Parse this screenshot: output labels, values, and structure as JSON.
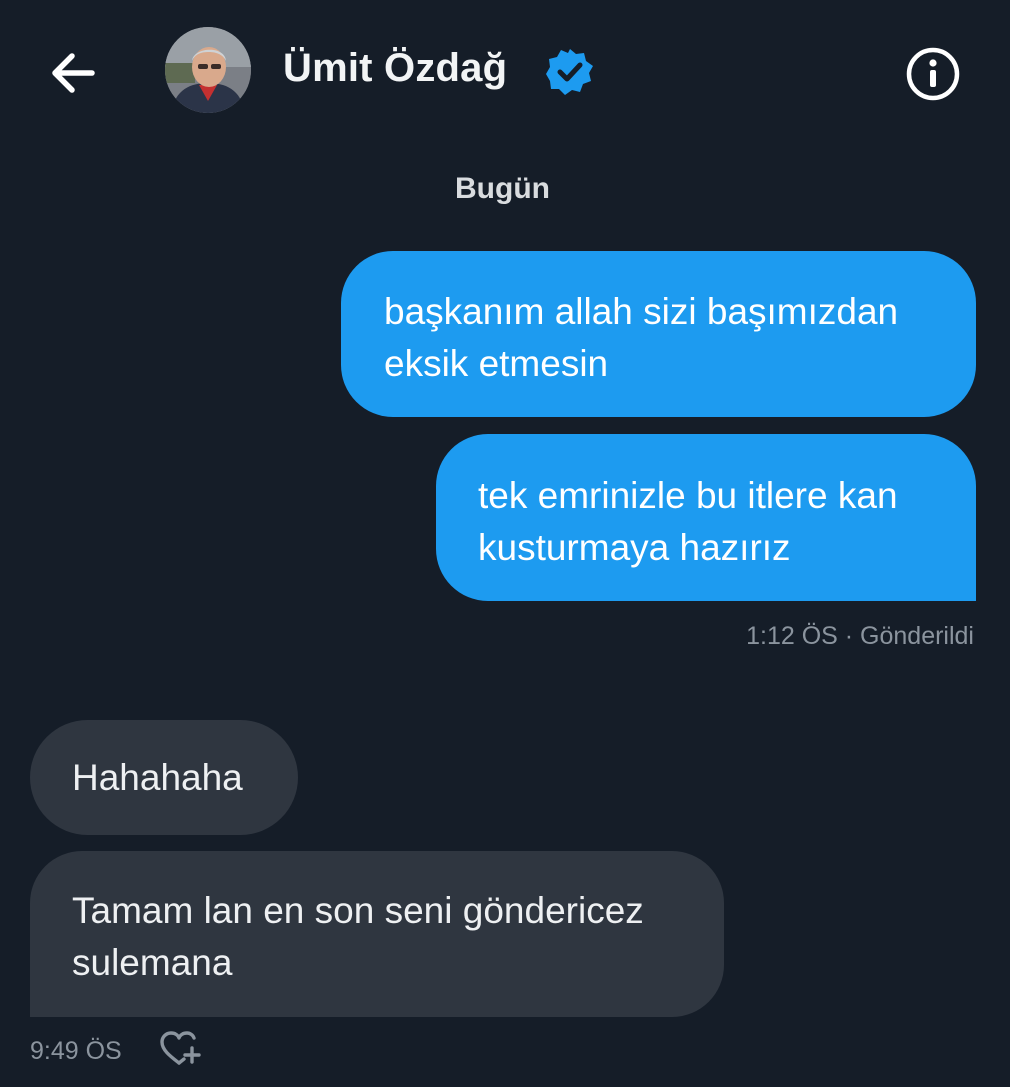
{
  "header": {
    "contact_name": "Ümit Özdağ",
    "back_icon": "arrow-left-icon",
    "verified_icon": "verified-badge-icon",
    "info_icon": "info-circle-icon",
    "verified_color": "#1d9bf0"
  },
  "conversation": {
    "day_label": "Bugün",
    "messages": [
      {
        "direction": "sent",
        "lines": [
          "başkanım allah sizi başımızdan",
          "eksik etmesin"
        ]
      },
      {
        "direction": "sent",
        "lines": [
          "tek emrinizle bu itlere kan",
          "kusturmaya hazırız"
        ]
      },
      {
        "direction": "received",
        "lines": [
          "Hahahaha"
        ]
      },
      {
        "direction": "received",
        "lines": [
          "Tamam lan en son seni göndericez",
          "sulemana"
        ]
      }
    ],
    "sent_status": "1:12 ÖS · Gönderildi",
    "received_time": "9:49 ÖS",
    "react_icon": "heart-add-icon"
  },
  "colors": {
    "background": "#151d28",
    "sent_bubble": "#1d9bf0",
    "received_bubble": "#2f3640",
    "meta_text": "#8b949e"
  }
}
